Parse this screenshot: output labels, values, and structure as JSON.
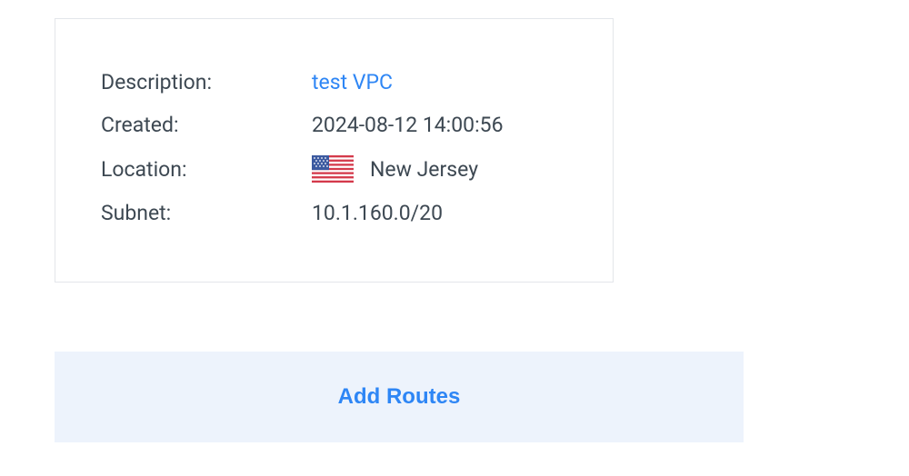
{
  "vpc": {
    "description_label": "Description:",
    "description_value": "test VPC",
    "created_label": "Created:",
    "created_value": "2024-08-12 14:00:56",
    "location_label": "Location:",
    "location_value": "New Jersey",
    "subnet_label": "Subnet:",
    "subnet_value": "10.1.160.0/20"
  },
  "actions": {
    "add_routes_label": "Add Routes"
  }
}
